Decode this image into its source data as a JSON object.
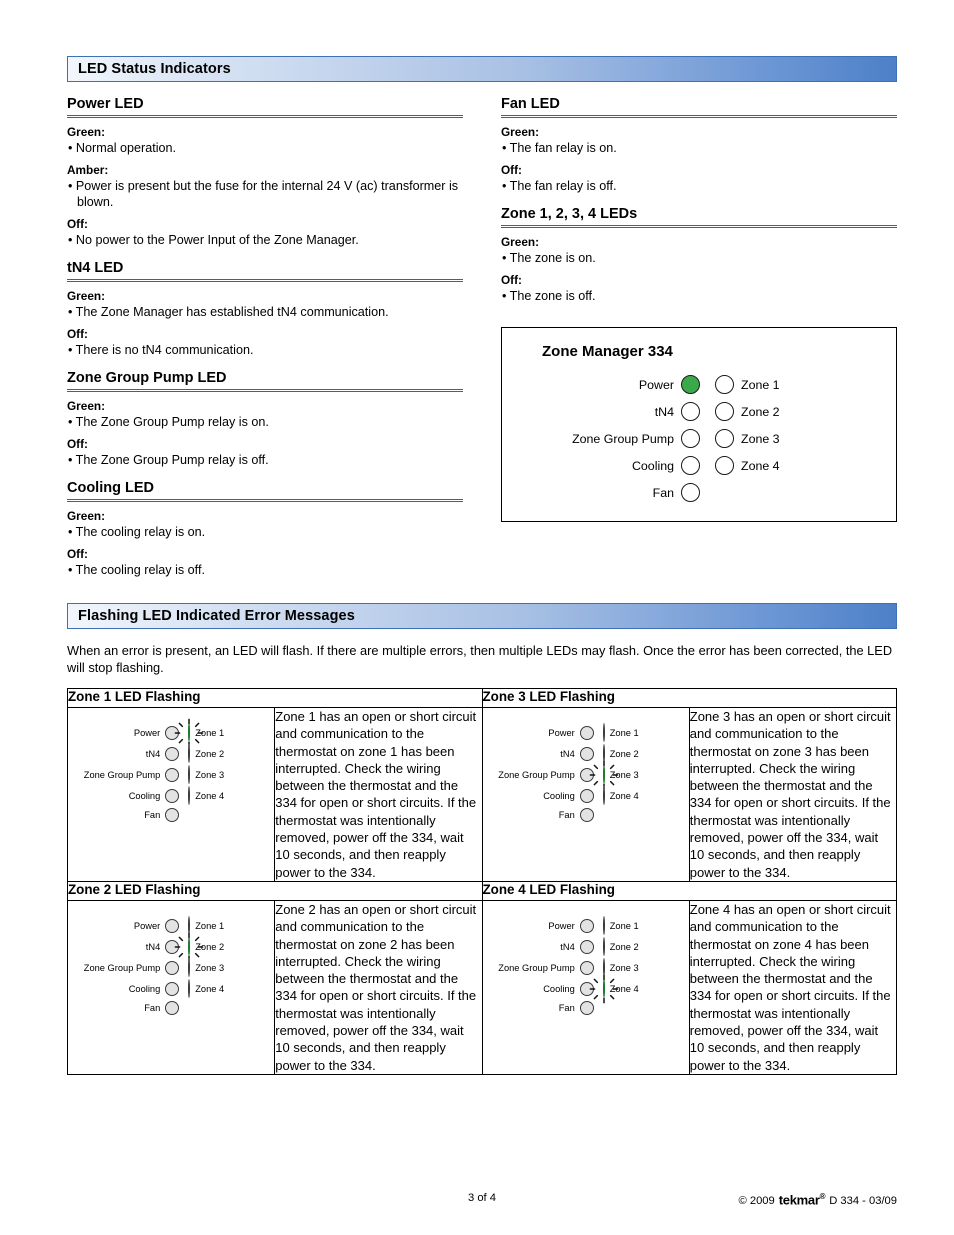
{
  "sections": {
    "status_banner": "LED Status Indicators",
    "error_banner": "Flashing LED Indicated Error Messages"
  },
  "left_column": [
    {
      "heading": "Power LED",
      "states": [
        {
          "state": "Green:",
          "text": "• Normal operation."
        },
        {
          "state": "Amber:",
          "text": "• Power is present but the fuse for the internal 24 V (ac) transformer is blown."
        },
        {
          "state": "Off:",
          "text": "• No power to the Power Input of the Zone Manager."
        }
      ]
    },
    {
      "heading": "tN4 LED",
      "states": [
        {
          "state": "Green:",
          "text": "• The Zone Manager has established tN4 communication."
        },
        {
          "state": "Off:",
          "text": "• There is no tN4 communication."
        }
      ]
    },
    {
      "heading": "Zone Group Pump LED",
      "states": [
        {
          "state": "Green:",
          "text": "• The Zone Group Pump relay is on."
        },
        {
          "state": "Off:",
          "text": "• The Zone Group Pump relay is off."
        }
      ]
    },
    {
      "heading": "Cooling LED",
      "states": [
        {
          "state": "Green:",
          "text": "• The cooling relay is on."
        },
        {
          "state": "Off:",
          "text": "• The cooling relay is off."
        }
      ]
    }
  ],
  "right_column": [
    {
      "heading": "Fan LED",
      "states": [
        {
          "state": "Green:",
          "text": "• The fan relay is on."
        },
        {
          "state": "Off:",
          "text": "• The fan relay is off."
        }
      ]
    },
    {
      "heading": "Zone 1, 2, 3, 4 LEDs",
      "states": [
        {
          "state": "Green:",
          "text": "• The zone is on."
        },
        {
          "state": "Off:",
          "text": "• The zone is off."
        }
      ]
    }
  ],
  "panel": {
    "title": "Zone Manager 334",
    "left_labels": [
      "Power",
      "tN4",
      "Zone Group Pump",
      "Cooling",
      "Fan"
    ],
    "right_labels": [
      "Zone 1",
      "Zone 2",
      "Zone 3",
      "Zone 4"
    ],
    "left_states": [
      "on",
      "off",
      "off",
      "off",
      "off"
    ],
    "right_states": [
      "off",
      "off",
      "off",
      "off"
    ]
  },
  "error_intro": "When an error is present, an LED will flash. If there are multiple errors, then multiple LEDs may flash. Once the error has been corrected, the LED will stop flashing.",
  "error_cells": [
    {
      "header": "Zone 1 LED Flashing",
      "flashing_index": 0,
      "text": "Zone 1 has an open or short circuit and communication to the thermostat on zone 1 has been interrupted. Check the wiring between the thermostat and the 334 for open or short circuits. If the thermostat was intentionally removed, power off the 334, wait 10 seconds, and then reapply power to the 334."
    },
    {
      "header": "Zone 3 LED Flashing",
      "flashing_index": 2,
      "text": "Zone 3 has an open or short circuit and communication to the thermostat on zone 3 has been interrupted. Check the wiring between the thermostat and the 334 for open or short circuits. If the thermostat was intentionally removed, power off the 334, wait 10 seconds, and then reapply power to the 334."
    },
    {
      "header": "Zone 2 LED Flashing",
      "flashing_index": 1,
      "text": "Zone 2 has an open or short circuit and communication to the thermostat on zone 2 has been interrupted. Check the wiring between the thermostat and the 334 for open or short circuits. If the thermostat was intentionally removed, power off the 334, wait 10 seconds, and then reapply power to the 334."
    },
    {
      "header": "Zone 4 LED Flashing",
      "flashing_index": 3,
      "text": "Zone 4 has an open or short circuit and communication to the thermostat on zone 4 has been interrupted. Check the wiring between the thermostat and the 334 for open or short circuits. If the thermostat was intentionally removed, power off the 334, wait 10 seconds, and then reapply power to the 334."
    }
  ],
  "mini_panel": {
    "left_labels": [
      "Power",
      "tN4",
      "Zone Group Pump",
      "Cooling",
      "Fan"
    ],
    "right_labels": [
      "Zone 1",
      "Zone 2",
      "Zone 3",
      "Zone 4"
    ]
  },
  "footer": {
    "page": "3 of 4",
    "copyright": "© 2009",
    "brand": "tekmar",
    "brand_mark": "®",
    "doc_code": "D 334 - 03/09"
  },
  "colors": {
    "banner_accent": "#4d80c8",
    "heading_rule": "#2f63ad",
    "led_on": "#3aa94b",
    "led_off_panel": "#ffffff",
    "led_off_mini": "#e3e3e3"
  }
}
